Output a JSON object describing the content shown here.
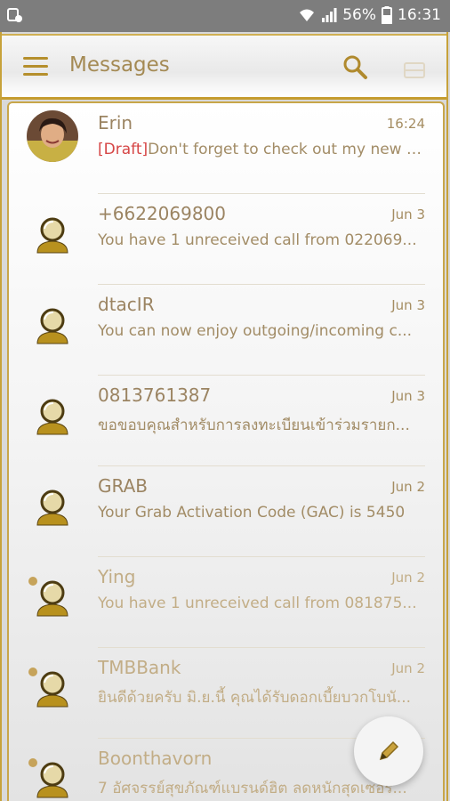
{
  "status_bar": {
    "battery": "56%",
    "time": "16:31"
  },
  "app_bar": {
    "title": "Messages"
  },
  "colors": {
    "gold": "#c59c2f",
    "draft_red": "#d64646",
    "text": "#a28c66"
  },
  "conversations": [
    {
      "name": "Erin",
      "date": "16:24",
      "draft_tag": "[Draft]",
      "preview": "Don't forget to check out my new t...",
      "has_photo": true,
      "unread": false
    },
    {
      "name": "+6622069800",
      "date": "Jun 3",
      "preview": "You have 1 unreceived call from 022069...",
      "has_photo": false,
      "unread": false
    },
    {
      "name": "dtacIR",
      "date": "Jun 3",
      "preview": "You can now enjoy outgoing/incoming c...",
      "has_photo": false,
      "unread": false
    },
    {
      "name": "0813761387",
      "date": "Jun 3",
      "preview": "ขอขอบคุณสำหรับการลงทะเบียนเข้าร่วมรายก...",
      "has_photo": false,
      "unread": false
    },
    {
      "name": "GRAB",
      "date": "Jun 2",
      "preview": "Your Grab Activation Code (GAC) is 5450",
      "has_photo": false,
      "unread": false
    },
    {
      "name": "Ying",
      "date": "Jun 2",
      "preview": "You have 1 unreceived call from 081875...",
      "has_photo": false,
      "unread": true
    },
    {
      "name": "TMBBank",
      "date": "Jun 2",
      "preview": "ยินดีด้วยครับ มิ.ย.นี้ คุณได้รับดอกเบี้ยบวกโบนั...",
      "has_photo": false,
      "unread": true
    },
    {
      "name": "Boonthavorn",
      "date": "",
      "preview": "7 อัศจรรย์สุขภัณฑ์แบรนด์ฮิต ลดหนักสุดเซอร์...",
      "has_photo": false,
      "unread": true
    }
  ]
}
